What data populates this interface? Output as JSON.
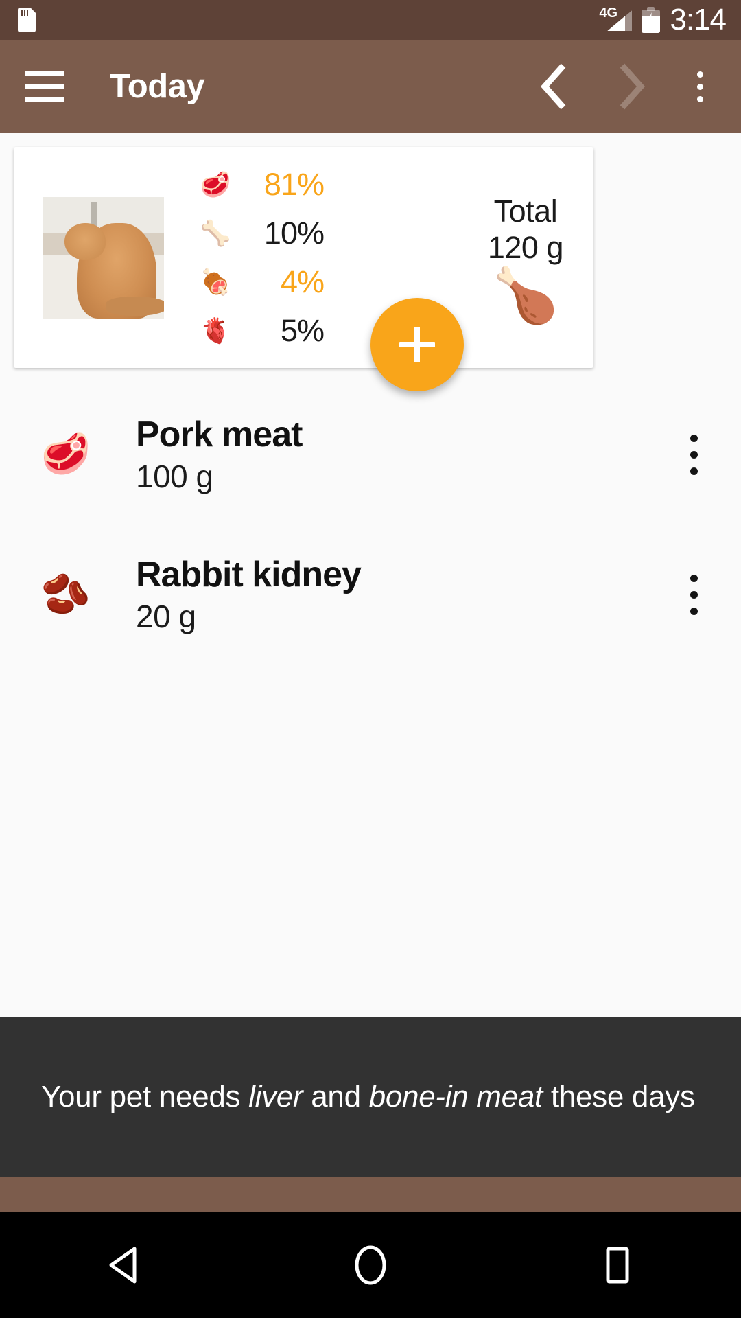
{
  "status_bar": {
    "sd_card_icon": "sd-card-icon",
    "network_label": "4G",
    "signal_icon": "signal-icon",
    "battery_icon": "battery-charging-icon",
    "time": "3:14"
  },
  "toolbar": {
    "menu_icon": "hamburger-menu-icon",
    "title": "Today",
    "prev_icon": "chevron-left-icon",
    "next_icon": "chevron-right-icon",
    "overflow_icon": "overflow-menu-icon"
  },
  "summary_card": {
    "pet_photo_alt": "pet-photo",
    "breakdown": [
      {
        "icon": "🥩",
        "icon_name": "muscle-meat-icon",
        "value": "81%",
        "highlighted": true
      },
      {
        "icon": "🦴",
        "icon_name": "bone-icon",
        "value": "10%",
        "highlighted": false
      },
      {
        "icon": "🍖",
        "icon_name": "liver-icon",
        "value": "4%",
        "highlighted": true
      },
      {
        "icon": "🫀",
        "icon_name": "organ-meat-icon",
        "value": "5%",
        "highlighted": false
      }
    ],
    "total_label": "Total",
    "total_value": "120 g",
    "total_icon": "🍗"
  },
  "fab": {
    "label": "+",
    "icon_name": "add-icon",
    "color": "#F9A51A"
  },
  "food_list": [
    {
      "icon": "🥩",
      "icon_name": "pork-meat-icon",
      "name": "Pork meat",
      "quantity": "100 g",
      "menu_icon": "overflow-menu-icon"
    },
    {
      "icon": "🫘",
      "icon_name": "rabbit-kidney-icon",
      "name": "Rabbit kidney",
      "quantity": "20 g",
      "menu_icon": "overflow-menu-icon"
    }
  ],
  "snackbar": {
    "text_part1": "Your pet needs ",
    "emphasis1": "liver",
    "text_part2": " and ",
    "emphasis2": "bone-in meat",
    "text_part3": " these days",
    "background": "#323232"
  },
  "navigation_bar": {
    "back_icon": "back-triangle-icon",
    "home_icon": "home-circle-icon",
    "recents_icon": "recents-square-icon"
  },
  "colors": {
    "status_bar": "#5E4237",
    "toolbar": "#7C5C4C",
    "accent": "#F9A51A",
    "page_background": "#FAFAFA"
  }
}
